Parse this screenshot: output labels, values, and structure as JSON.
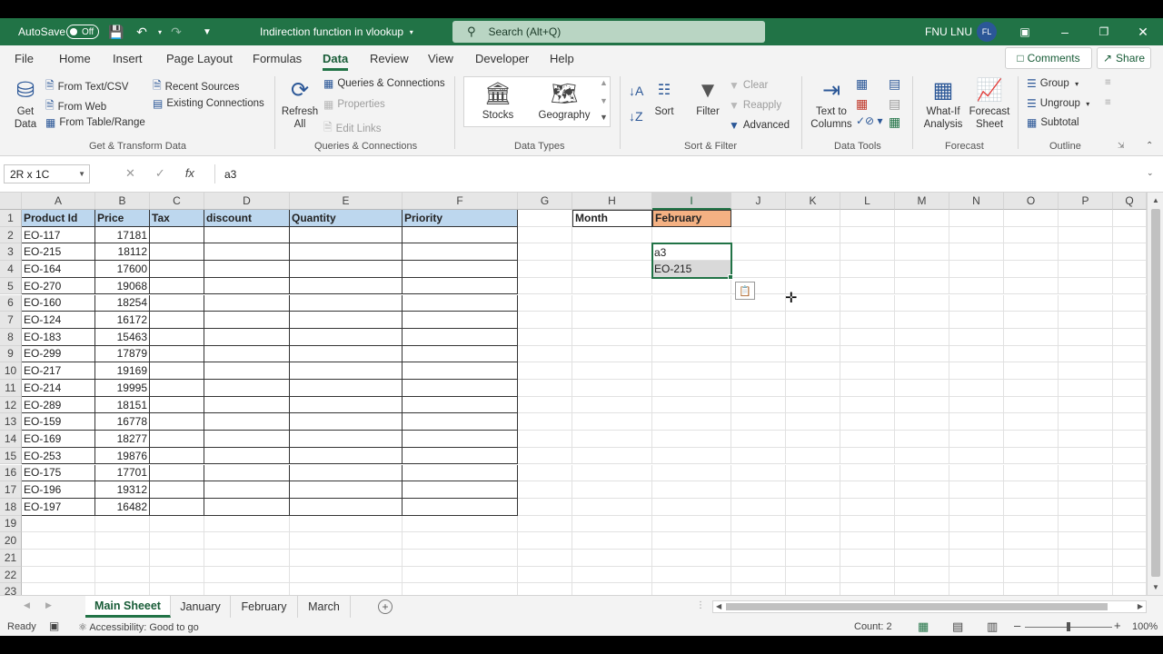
{
  "titlebar": {
    "autosave_label": "AutoSave",
    "autosave_state": "Off",
    "doc_title": "Indirection function in vlookup",
    "search_placeholder": "Search (Alt+Q)",
    "user_name": "FNU LNU",
    "user_initials": "FL"
  },
  "menu": {
    "tabs": [
      "File",
      "Home",
      "Insert",
      "Page Layout",
      "Formulas",
      "Data",
      "Review",
      "View",
      "Developer",
      "Help"
    ],
    "active": "Data",
    "comments_label": "Comments",
    "share_label": "Share"
  },
  "ribbon": {
    "get_data": "Get Data",
    "from_text_csv": "From Text/CSV",
    "from_web": "From Web",
    "from_table_range": "From Table/Range",
    "recent_sources": "Recent Sources",
    "existing_connections": "Existing Connections",
    "group_get_transform": "Get & Transform Data",
    "refresh_all": "Refresh All",
    "queries_connections": "Queries & Connections",
    "properties": "Properties",
    "edit_links": "Edit Links",
    "group_queries": "Queries & Connections",
    "stocks": "Stocks",
    "geography": "Geography",
    "group_data_types": "Data Types",
    "sort": "Sort",
    "filter": "Filter",
    "clear": "Clear",
    "reapply": "Reapply",
    "advanced": "Advanced",
    "group_sort_filter": "Sort & Filter",
    "text_to_columns": "Text to Columns",
    "group_data_tools": "Data Tools",
    "what_if": "What-If Analysis",
    "forecast_sheet": "Forecast Sheet",
    "group_forecast": "Forecast",
    "group_btn": "Group",
    "ungroup_btn": "Ungroup",
    "subtotal": "Subtotal",
    "group_outline": "Outline"
  },
  "formula_bar": {
    "name_box": "2R x 1C",
    "fx": "fx",
    "formula": "a3"
  },
  "columns": [
    "A",
    "B",
    "C",
    "D",
    "E",
    "F",
    "G",
    "H",
    "I",
    "J",
    "K",
    "L",
    "M",
    "N",
    "O",
    "P",
    "Q"
  ],
  "rows": [
    "1",
    "2",
    "3",
    "4",
    "5",
    "6",
    "7",
    "8",
    "9",
    "10",
    "11",
    "12",
    "13",
    "14",
    "15",
    "16",
    "17",
    "18",
    "19",
    "20",
    "21",
    "22",
    "23"
  ],
  "table": {
    "headers": [
      "Product Id",
      "Price",
      "Tax",
      "discount",
      "Quantity",
      "Priority"
    ],
    "rows": [
      [
        "EO-117",
        "17181"
      ],
      [
        "EO-215",
        "18112"
      ],
      [
        "EO-164",
        "17600"
      ],
      [
        "EO-270",
        "19068"
      ],
      [
        "EO-160",
        "18254"
      ],
      [
        "EO-124",
        "16172"
      ],
      [
        "EO-183",
        "15463"
      ],
      [
        "EO-299",
        "17879"
      ],
      [
        "EO-217",
        "19169"
      ],
      [
        "EO-214",
        "19995"
      ],
      [
        "EO-289",
        "18151"
      ],
      [
        "EO-159",
        "16778"
      ],
      [
        "EO-169",
        "18277"
      ],
      [
        "EO-253",
        "19876"
      ],
      [
        "EO-175",
        "17701"
      ],
      [
        "EO-196",
        "19312"
      ],
      [
        "EO-197",
        "16482"
      ]
    ]
  },
  "side": {
    "month_label": "Month",
    "month_value": "February",
    "i3": "a3",
    "i4": "EO-215"
  },
  "sheets": [
    "Main Sheeet",
    "January",
    "February",
    "March"
  ],
  "active_sheet": "Main Sheeet",
  "status": {
    "ready": "Ready",
    "accessibility": "Accessibility: Good to go",
    "count": "Count: 2",
    "zoom": "100%"
  },
  "colors": {
    "accent": "#217346",
    "header_fill": "#bdd7ee",
    "month_fill": "#f4b183"
  }
}
